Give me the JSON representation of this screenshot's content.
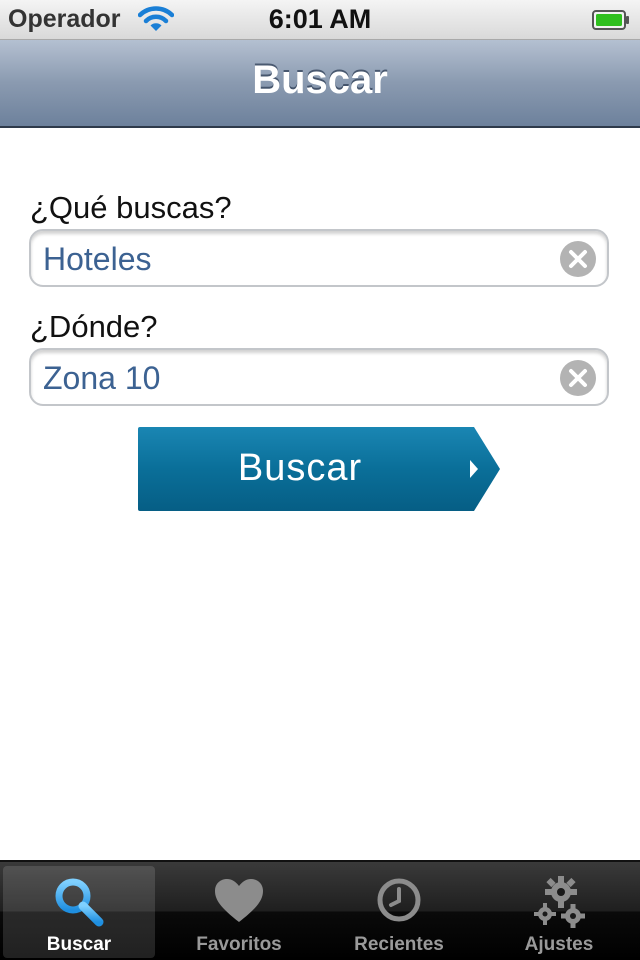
{
  "status_bar": {
    "carrier": "Operador",
    "time": "6:01 AM",
    "wifi_icon": "wifi-icon",
    "battery_icon": "battery-icon",
    "battery_level": 1.0
  },
  "nav_bar": {
    "title": "Buscar"
  },
  "form": {
    "what_label": "¿Qué buscas?",
    "what_value": "Hoteles",
    "where_label": "¿Dónde?",
    "where_value": "Zona 10",
    "clear_icon": "clear-icon",
    "search_button_label": "Buscar"
  },
  "tab_bar": {
    "selected_index": 0,
    "tabs": [
      {
        "label": "Buscar",
        "icon": "magnifier-icon"
      },
      {
        "label": "Favoritos",
        "icon": "heart-icon"
      },
      {
        "label": "Recientes",
        "icon": "clock-icon"
      },
      {
        "label": "Ajustes",
        "icon": "gears-icon"
      }
    ]
  },
  "colors": {
    "nav_bar": "#8a9ab0",
    "field_text": "#3c6292",
    "search_button": "#0a6f99",
    "tab_selected_icon": "#3aa3e6"
  }
}
